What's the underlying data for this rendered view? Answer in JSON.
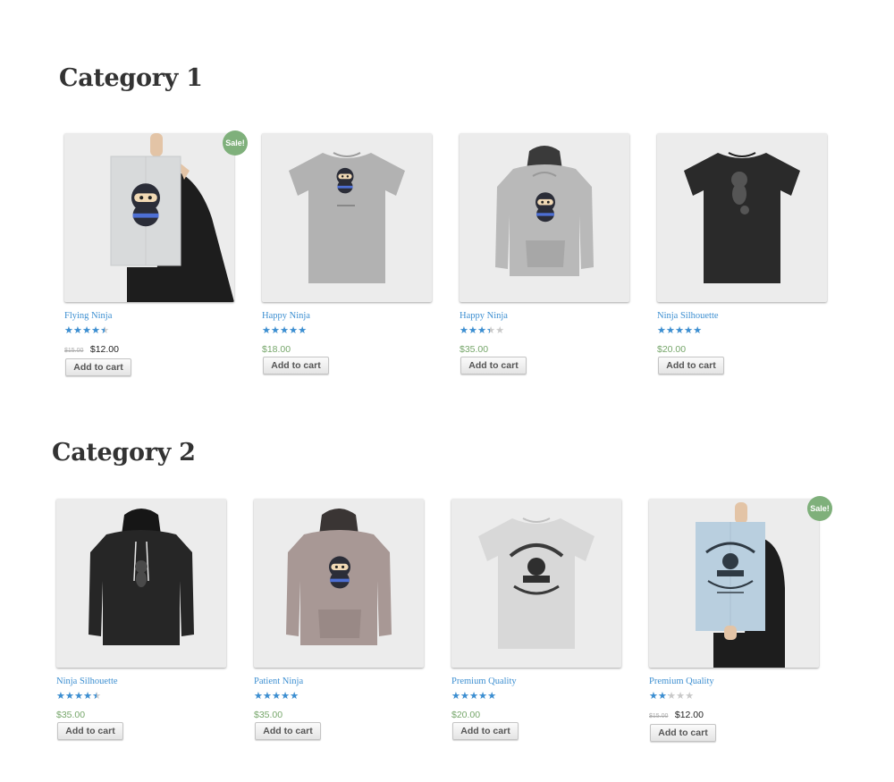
{
  "categories": [
    {
      "title": "Category 1",
      "products": [
        {
          "name": "Flying Ninja",
          "rating": 4,
          "old_price": "$15.00",
          "price": "$12.00",
          "sale": true,
          "sale_label": "Sale!",
          "button": "Add to cart",
          "image": "poster-ninja"
        },
        {
          "name": "Happy Ninja",
          "rating": 5,
          "price": "$18.00",
          "sale": false,
          "button": "Add to cart",
          "image": "tshirt-grey-ninja"
        },
        {
          "name": "Happy Ninja",
          "rating": 3,
          "price": "$35.00",
          "sale": false,
          "button": "Add to cart",
          "image": "hoodie-grey-ninja"
        },
        {
          "name": "Ninja Silhouette",
          "rating": 5,
          "price": "$20.00",
          "sale": false,
          "button": "Add to cart",
          "image": "tshirt-black-silhouette"
        }
      ]
    },
    {
      "title": "Category 2",
      "products": [
        {
          "name": "Ninja Silhouette",
          "rating": 4,
          "price": "$35.00",
          "sale": false,
          "button": "Add to cart",
          "image": "hoodie-black-silhouette"
        },
        {
          "name": "Patient Ninja",
          "rating": 5,
          "price": "$35.00",
          "sale": false,
          "button": "Add to cart",
          "image": "hoodie-pink-ninja"
        },
        {
          "name": "Premium Quality",
          "rating": 4.5,
          "price": "$20.00",
          "sale": false,
          "button": "Add to cart",
          "image": "tshirt-white-woothemes"
        },
        {
          "name": "Premium Quality",
          "rating": 2,
          "old_price": "$15.00",
          "price": "$12.00",
          "sale": true,
          "sale_label": "Sale!",
          "button": "Add to cart",
          "image": "poster-woothemes"
        }
      ]
    }
  ],
  "colors": {
    "link": "#3d8fd1",
    "price": "#76a66a",
    "star": "#3b8fd3",
    "sale_badge": "#7fb07b"
  }
}
